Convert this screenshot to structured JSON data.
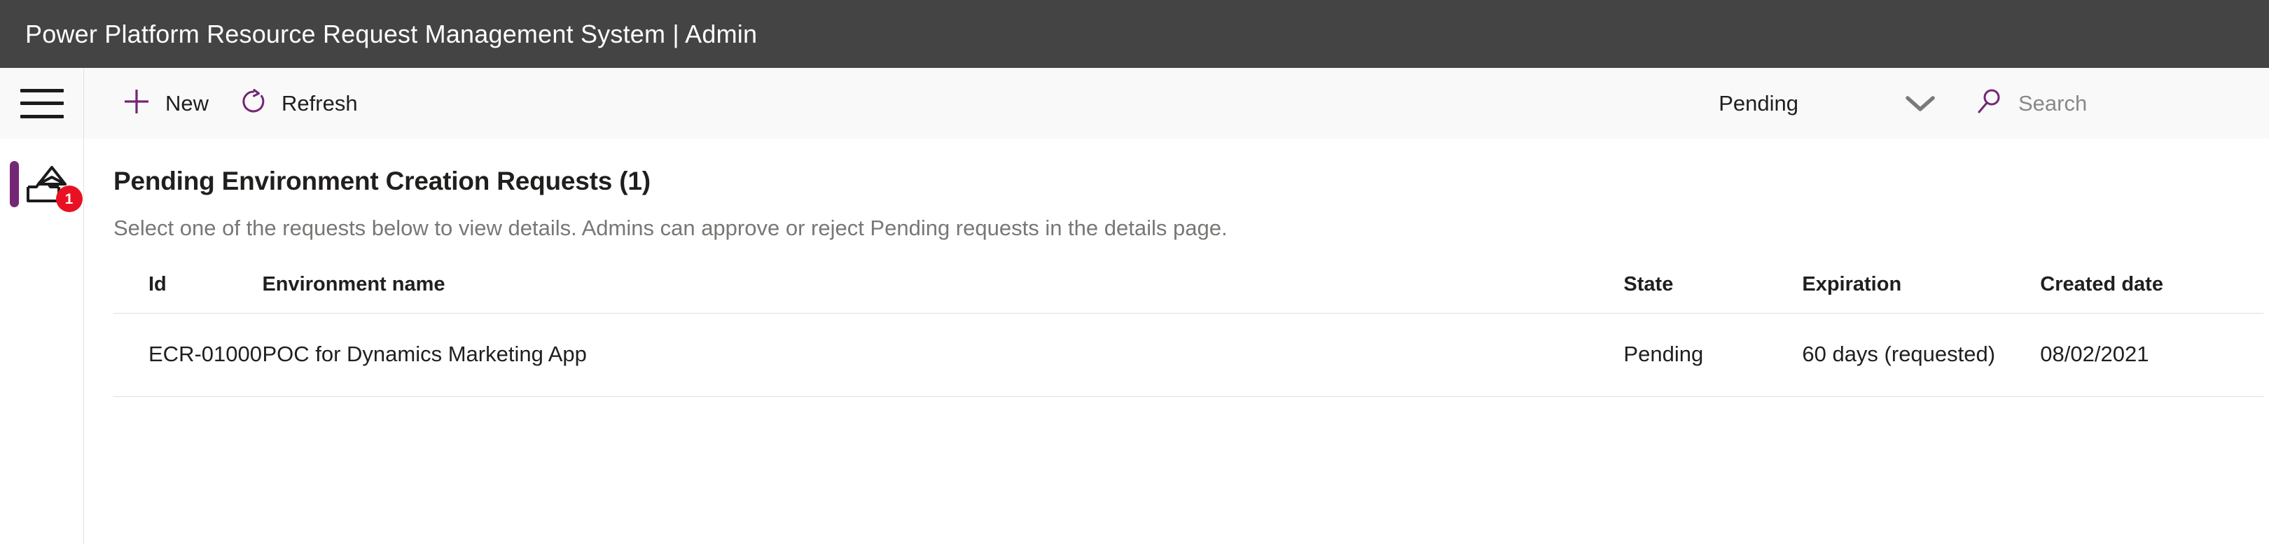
{
  "titlebar": {
    "title": "Power Platform Resource Request Management System | Admin"
  },
  "rail": {
    "menu_icon": "hamburger-menu-icon",
    "items": [
      {
        "icon": "inbox-tray-icon",
        "badge": "1",
        "active": true
      }
    ]
  },
  "commandbar": {
    "new_label": "New",
    "new_icon": "plus-icon",
    "refresh_label": "Refresh",
    "refresh_icon": "refresh-circular-arrow-icon",
    "filter_value": "Pending",
    "filter_chevron_icon": "chevron-down-icon",
    "search_icon": "search-icon",
    "search_placeholder": "Search",
    "search_value": ""
  },
  "content": {
    "page_title": "Pending Environment Creation Requests (1)",
    "page_subtitle": "Select one of the requests below to view details. Admins can approve or reject Pending requests in the details page."
  },
  "table": {
    "columns": [
      "Id",
      "Environment name",
      "State",
      "Expiration",
      "Created date"
    ],
    "rows": [
      {
        "id": "ECR-01000",
        "environment_name": "POC for Dynamics Marketing App",
        "state": "Pending",
        "expiration": "60 days (requested)",
        "created_date": "08/02/2021"
      }
    ]
  },
  "colors": {
    "titlebar_bg": "#444444",
    "accent_purple": "#742774",
    "badge_red": "#e81123",
    "commandbar_bg": "#f9f9f9",
    "text_primary": "#201f1e",
    "text_secondary": "#797775"
  }
}
